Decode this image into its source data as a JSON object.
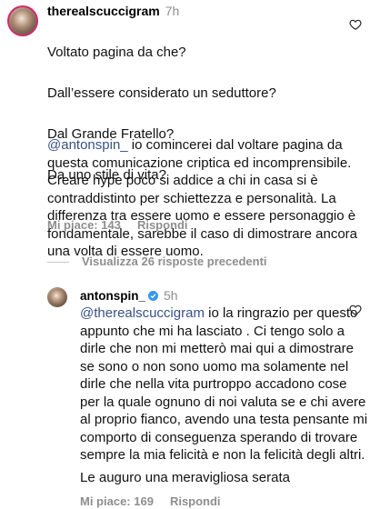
{
  "comment1": {
    "username": "therealscuccigram",
    "time": "7h",
    "lines": [
      "Voltato pagina da che?",
      "Dall’essere considerato un seduttore?",
      "Dal Grande Fratello?",
      "Da uno stile di vita?"
    ]
  },
  "reply1": {
    "mention": "@antonspin_",
    "text": " io comincerei dal voltare pagina da questa comunicazione criptica ed incomprensibile. Creare hype poco si addice a chi in casa si è contraddistinto per schiettezza e personalità. La differenza tra essere uomo e essere personaggio è fondamentale, sarebbe il caso di dimostrare ancora una volta di essere uomo.",
    "likes": "Mi piace: 143",
    "reply_label": "Rispondi"
  },
  "view_more": "Visualizza 26 risposte precedenti",
  "comment2": {
    "username": "antonspin_",
    "time": "5h",
    "mention": "@therealscuccigram",
    "text": " io la ringrazio per questo appunto che mi ha lasciato . Ci tengo solo a dirle che non mi metterò mai qui a dimostrare se sono o non sono uomo ma solamente nel dirle che nella vita purtroppo accadono cose per la quale ognuno di noi valuta se e chi avere al proprio fianco, avendo una testa pensante mi comporto di conseguenza sperando di trovare sempre la mia felicità e non la felicità degli altri.",
    "closing": "Le auguro una meravigliosa serata",
    "likes": "Mi piace: 169",
    "reply_label": "Rispondi"
  },
  "colors": {
    "mention": "#385185",
    "muted": "#8e8e8e",
    "verified": "#3897f0"
  }
}
